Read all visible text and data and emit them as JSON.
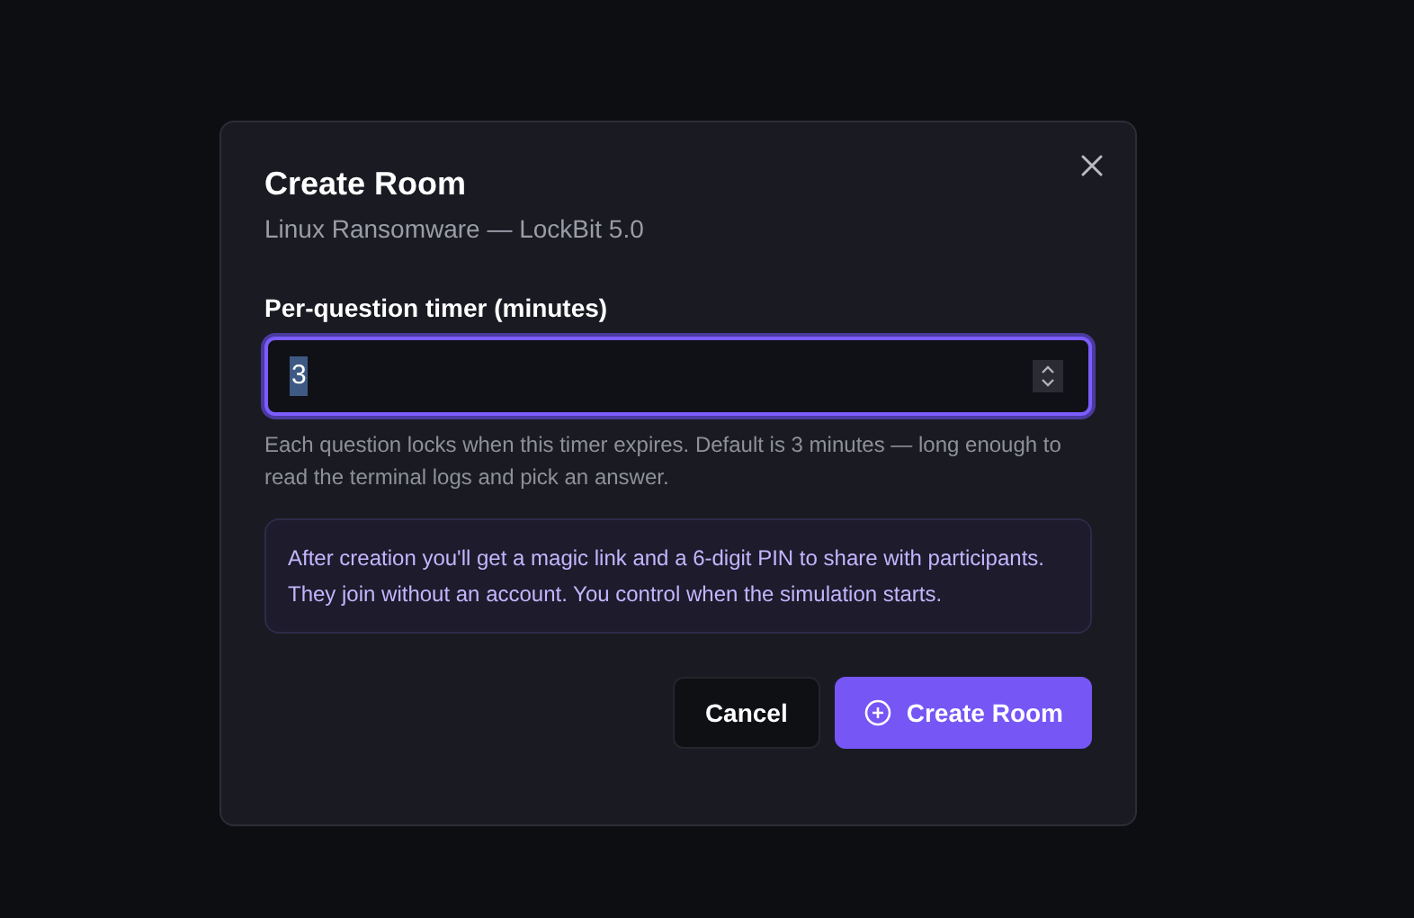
{
  "dialog": {
    "title": "Create Room",
    "subtitle": "Linux Ransomware — LockBit 5.0",
    "field": {
      "label": "Per-question timer (minutes)",
      "value": "3",
      "focused": true,
      "help": "Each question locks when this timer expires. Default is 3 minutes — long enough to read the terminal logs and pick an answer."
    },
    "info": "After creation you'll get a magic link and a 6-digit PIN to share with participants. They join without an account. You control when the simulation starts.",
    "buttons": [
      {
        "label": "Cancel",
        "kind": "secondary"
      },
      {
        "label": "Create Room",
        "kind": "primary"
      }
    ]
  }
}
